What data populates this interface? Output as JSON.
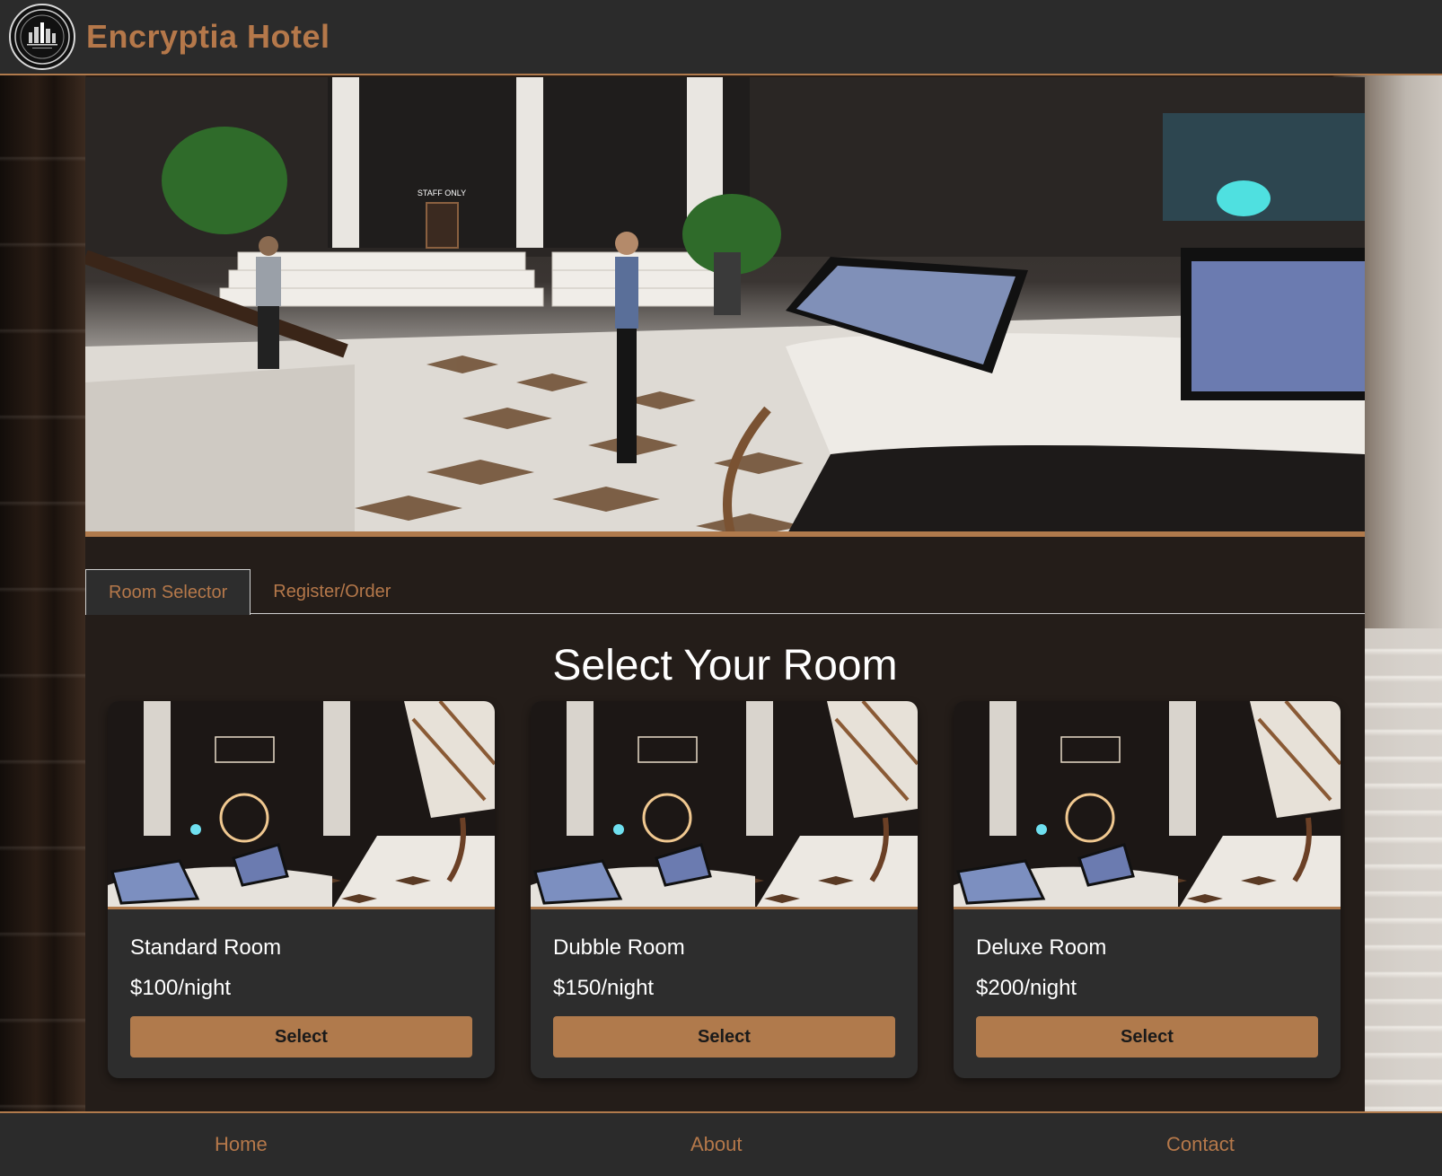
{
  "header": {
    "title": "Encryptia Hotel",
    "logo_icon": "hotel-logo-icon"
  },
  "hero": {
    "image_icon": "hotel-lobby-image",
    "sign_text": "STAFF ONLY"
  },
  "tabs": [
    {
      "label": "Room Selector",
      "active": true
    },
    {
      "label": "Register/Order",
      "active": false
    }
  ],
  "room_selector": {
    "heading": "Select Your Room",
    "rooms": [
      {
        "name": "Standard Room",
        "price": "$100/night",
        "button": "Select"
      },
      {
        "name": "Dubble Room",
        "price": "$150/night",
        "button": "Select"
      },
      {
        "name": "Deluxe Room",
        "price": "$200/night",
        "button": "Select"
      }
    ]
  },
  "footer": {
    "links": [
      "Home",
      "About",
      "Contact"
    ]
  },
  "colors": {
    "accent": "#b07a4c",
    "header_bg": "#2b2b2b",
    "panel_bg": "#241d19",
    "card_bg": "#2d2d2d"
  }
}
